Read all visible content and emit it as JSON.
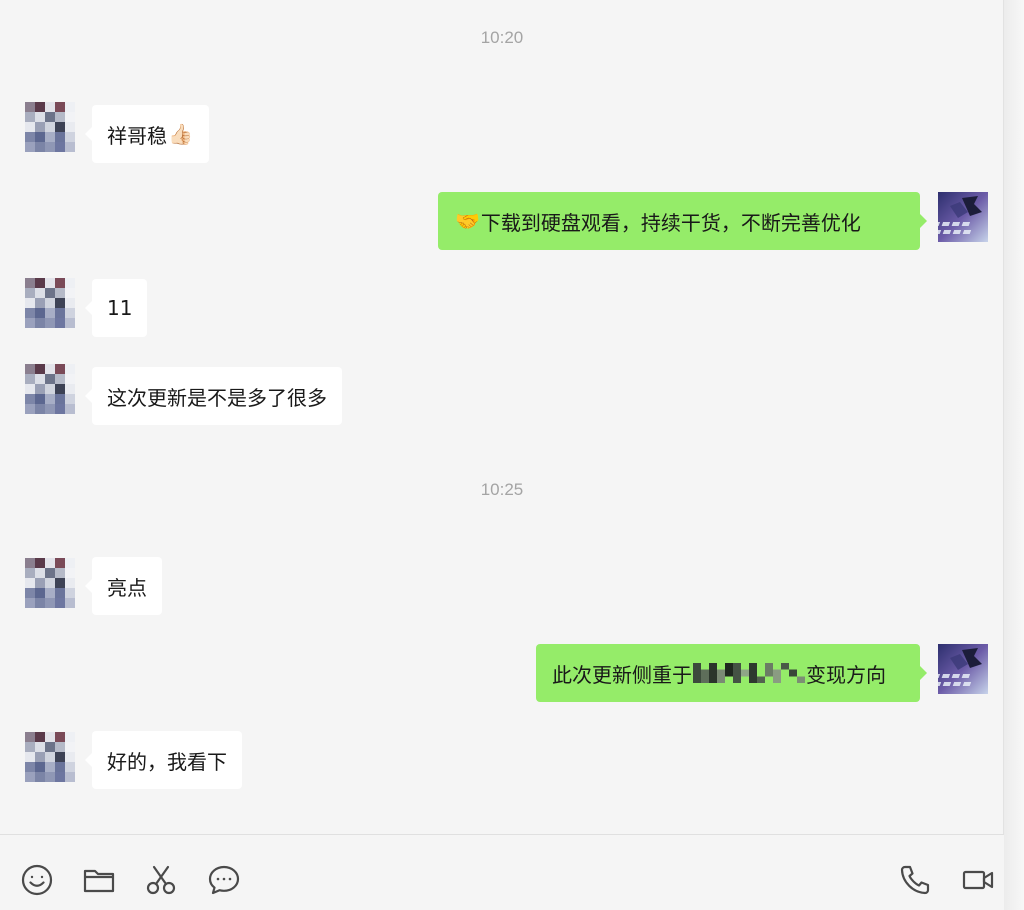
{
  "conversation": {
    "timestamps": [
      "10:20",
      "10:25"
    ],
    "messages": [
      {
        "side": "received",
        "text": "祥哥稳",
        "emoji": "👍🏻"
      },
      {
        "side": "sent",
        "emoji": "🤝",
        "text": "下载到硬盘观看，持续干货，不断完善优化"
      },
      {
        "side": "received",
        "text": "11"
      },
      {
        "side": "received",
        "text": "这次更新是不是多了很多"
      },
      {
        "side": "received",
        "text": "亮点"
      },
      {
        "side": "sent",
        "text_before": "此次更新侧重于",
        "text_after": "变现方向"
      },
      {
        "side": "received",
        "text": "好的，我看下"
      }
    ]
  },
  "toolbar": {
    "left_icons": [
      "emoji-icon",
      "folder-icon",
      "scissors-icon",
      "chat-history-icon"
    ],
    "right_icons": [
      "phone-icon",
      "video-call-icon"
    ]
  },
  "colors": {
    "background": "#f5f5f5",
    "sent_bubble": "#95ec69",
    "received_bubble": "#ffffff",
    "timestamp_text": "#a4a4a4"
  }
}
